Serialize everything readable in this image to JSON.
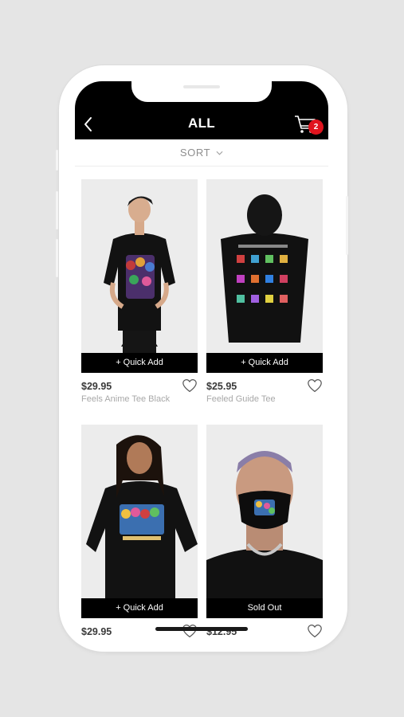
{
  "header": {
    "title": "ALL",
    "back_icon": "chevron-left-icon",
    "cart_icon": "cart-icon",
    "cart_count": "2",
    "badge_color": "#e0141e"
  },
  "sort": {
    "label": "SORT",
    "icon": "chevron-down-icon"
  },
  "products": [
    {
      "price": "$29.95",
      "name": "Feels Anime Tee Black",
      "action": "+ Quick Add"
    },
    {
      "price": "$25.95",
      "name": "Feeled Guide Tee",
      "action": "+ Quick Add"
    },
    {
      "price": "$29.95",
      "name": "",
      "action": "+ Quick Add"
    },
    {
      "price": "$12.95",
      "name": "",
      "action": "Sold Out"
    }
  ]
}
